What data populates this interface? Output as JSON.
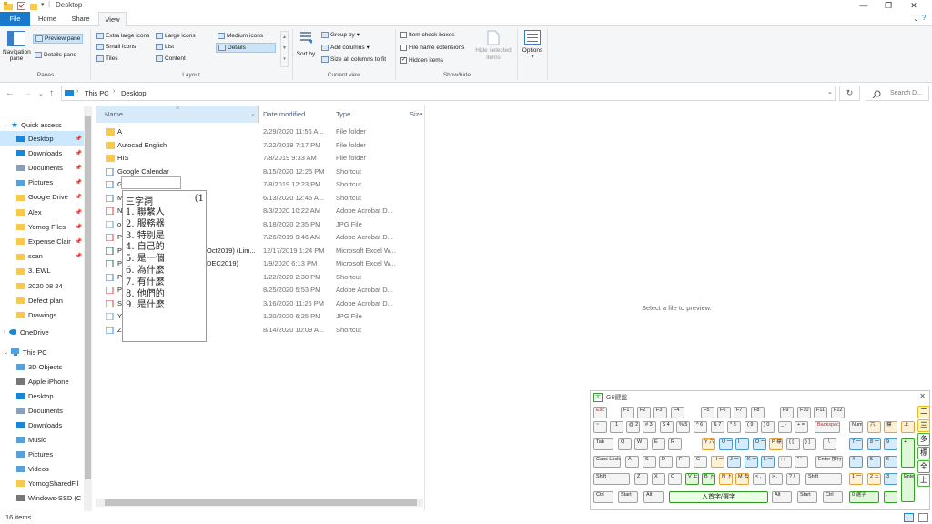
{
  "window": {
    "title": "Desktop"
  },
  "ribbon_tabs": [
    "File",
    "Home",
    "Share",
    "View"
  ],
  "ribbon": {
    "panes": {
      "navigation_pane": "Navigation pane",
      "preview_pane": "Preview pane",
      "details_pane": "Details pane",
      "group": "Panes"
    },
    "layout": {
      "extra_large": "Extra large icons",
      "large": "Large icons",
      "medium": "Medium icons",
      "small": "Small icons",
      "list": "List",
      "details": "Details",
      "tiles": "Tiles",
      "content": "Content",
      "group": "Layout"
    },
    "current_view": {
      "sort_by": "Sort by",
      "group_by": "Group by",
      "add_columns": "Add columns",
      "size_all": "Size all columns to fit",
      "group": "Current view"
    },
    "show_hide": {
      "item_check_boxes": "Item check boxes",
      "file_name_extensions": "File name extensions",
      "hidden_items": "Hidden items",
      "hide_selected": "Hide selected items",
      "group": "Show/hide"
    },
    "options": "Options"
  },
  "address": {
    "path": [
      "This PC",
      "Desktop"
    ],
    "search_placeholder": "Search D..."
  },
  "nav": {
    "quick_access": "Quick access",
    "items": [
      {
        "label": "Desktop",
        "pinned": true,
        "selected": true
      },
      {
        "label": "Downloads",
        "pinned": true
      },
      {
        "label": "Documents",
        "pinned": true
      },
      {
        "label": "Pictures",
        "pinned": true
      },
      {
        "label": "Google Drive",
        "pinned": true
      },
      {
        "label": "Alex",
        "pinned": true
      },
      {
        "label": "Yomog Files",
        "pinned": true
      },
      {
        "label": "Expense Clair",
        "pinned": true
      },
      {
        "label": "scan",
        "pinned": true
      },
      {
        "label": "3. EWL"
      },
      {
        "label": "2020 08 24"
      },
      {
        "label": "Defect plan"
      },
      {
        "label": "Drawings"
      }
    ],
    "onedrive": "OneDrive",
    "this_pc": "This PC",
    "pc_items": [
      "3D Objects",
      "Apple iPhone",
      "Desktop",
      "Documents",
      "Downloads",
      "Music",
      "Pictures",
      "Videos",
      "YomogSharedFil",
      "Windows-SSD (C"
    ]
  },
  "columns": {
    "name": "Name",
    "date": "Date modified",
    "type": "Type",
    "size": "Size"
  },
  "files": [
    {
      "name": "A",
      "date": "2/29/2020 11:56 A...",
      "type": "File folder",
      "icon": "folder-icon"
    },
    {
      "name": "Autocad English",
      "date": "7/22/2019 7:17 PM",
      "type": "File folder",
      "icon": "folder-icon"
    },
    {
      "name": "HIS",
      "date": "7/8/2019 9:33 AM",
      "type": "File folder",
      "icon": "folder-icon"
    },
    {
      "name": "Google Calendar",
      "date": "8/15/2020 12:25 PM",
      "type": "Shortcut",
      "icon": "calendar-icon"
    },
    {
      "name": "G",
      "date": "7/8/2019 12:23 PM",
      "type": "Shortcut",
      "icon": "shortcut-icon"
    },
    {
      "name": "M",
      "date": "6/13/2020 12:45 A...",
      "type": "Shortcut",
      "icon": "shortcut-icon"
    },
    {
      "name": "N",
      "date": "8/3/2020 10:22 AM",
      "type": "Adobe Acrobat D...",
      "icon": "pdf-icon"
    },
    {
      "name": "o",
      "date": "8/18/2020 2:35 PM",
      "type": "JPG File",
      "icon": "image-icon"
    },
    {
      "name": "P",
      "date": "7/26/2019 9:46 AM",
      "type": "Adobe Acrobat D...",
      "icon": "pdf-icon"
    },
    {
      "name": "P",
      "name_tail": "Oct2019) (Lim...",
      "date": "12/17/2019 1:24 PM",
      "type": "Microsoft Excel W...",
      "icon": "excel-icon"
    },
    {
      "name": "P",
      "name_tail": "DEC2019)",
      "date": "1/9/2020 6:13 PM",
      "type": "Microsoft Excel W...",
      "icon": "excel-icon"
    },
    {
      "name": "P",
      "date": "1/22/2020 2:30 PM",
      "type": "Shortcut",
      "icon": "shortcut-icon"
    },
    {
      "name": "P",
      "date": "8/25/2020 5:53 PM",
      "type": "Adobe Acrobat D...",
      "icon": "pdf-icon"
    },
    {
      "name": "S",
      "date": "3/16/2020 11:26 PM",
      "type": "Adobe Acrobat D...",
      "icon": "pdf-icon"
    },
    {
      "name": "Y",
      "date": "1/20/2020 6:25 PM",
      "type": "JPG File",
      "icon": "image-icon"
    },
    {
      "name": "Z",
      "date": "8/14/2020 10:09 A...",
      "type": "Shortcut",
      "icon": "zoom-icon"
    }
  ],
  "preview_message": "Select a file to preview.",
  "status": "16 items",
  "ime": {
    "header": "三字詞",
    "page": "(1",
    "candidates": [
      "1.  聯繫人",
      "2.  服務器",
      "3.  特別是",
      "4.  自己的",
      "5.  是一個",
      "6.  為什麼",
      "7.  有什麼",
      "8.  他們的",
      "9.  是什麼"
    ]
  },
  "keyboard": {
    "title": "G6鍵盤",
    "space_label": "入首字/選字",
    "side_buttons": [
      "二",
      "三",
      "多",
      "標",
      "全",
      "上"
    ]
  }
}
